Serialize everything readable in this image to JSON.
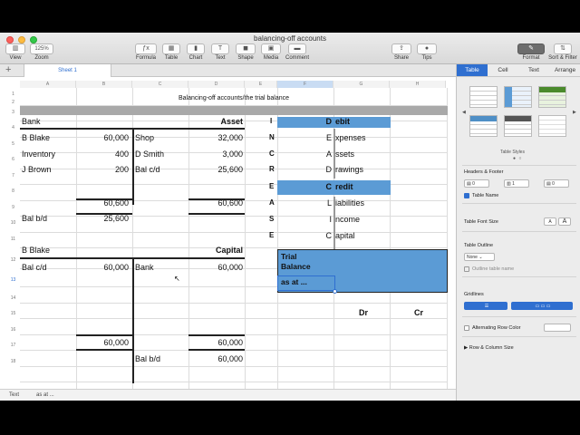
{
  "window": {
    "doc_title": "balancing-off accounts",
    "zoom_value": "125%"
  },
  "toolbar": {
    "view": "View",
    "zoom": "Zoom",
    "formula": "Formula",
    "table": "Table",
    "chart": "Chart",
    "text": "Text",
    "shape": "Shape",
    "media": "Media",
    "comment": "Comment",
    "share": "Share",
    "tips": "Tips",
    "format": "Format",
    "sort_filter": "Sort & Filter"
  },
  "sheet_tab": "Sheet 1",
  "columns": [
    "A",
    "B",
    "C",
    "D",
    "E",
    "F",
    "G",
    "H"
  ],
  "rows": [
    "1",
    "2",
    "3",
    "4",
    "5",
    "6",
    "7",
    "8",
    "9",
    "10",
    "11",
    "12",
    "13",
    "14",
    "15",
    "16",
    "17",
    "18"
  ],
  "heading": "Balancing-off accounts/the trial balance",
  "ledger": {
    "bank_title": "Bank",
    "asset_label": "Asset",
    "b_blake": "B Blake",
    "b_blake_amt": "60,000",
    "shop": "Shop",
    "shop_amt": "32,000",
    "inventory": "Inventory",
    "inventory_amt": "400",
    "d_smith": "D Smith",
    "d_smith_amt": "3,000",
    "j_brown": "J Brown",
    "j_brown_amt": "200",
    "bal_cd": "Bal c/d",
    "bal_cd_amt": "25,600",
    "total_left": "60,600",
    "total_right": "60,600",
    "bal_bd": "Bal b/d",
    "bal_bd_amt": "25,600",
    "b_blake2": "B Blake",
    "capital_label": "Capital",
    "bal_cd2": "Bal c/d",
    "bal_cd2_amt": "60,000",
    "bank2": "Bank",
    "bank2_amt": "60,000",
    "total2_left": "60,000",
    "total2_right": "60,000",
    "bal_bd2": "Bal b/d",
    "bal_bd2_amt": "60,000"
  },
  "dealer": {
    "letters": [
      "I",
      "N",
      "C",
      "R",
      "E",
      "A",
      "S",
      "E"
    ],
    "first": [
      "D",
      "E",
      "A",
      "D",
      "C",
      "L",
      "I",
      "C"
    ],
    "rest": [
      "ebit",
      "xpenses",
      "ssets",
      "rawings",
      "redit",
      "iabilities",
      "ncome",
      "apital"
    ]
  },
  "trial": {
    "line1": "Trial",
    "line2": "Balance",
    "line3": "as at ...",
    "dr": "Dr",
    "cr": "Cr"
  },
  "status": {
    "type": "Text",
    "content": "as at ..."
  },
  "inspector": {
    "tabs": [
      "Table",
      "Cell",
      "Text",
      "Arrange"
    ],
    "table_styles": "Table Styles",
    "headers_footer": "Headers & Footer",
    "header_rows": "0",
    "header_cols": "1",
    "footer_rows": "0",
    "table_name": "Table Name",
    "table_font_size": "Table Font Size",
    "font_small": "A",
    "font_large": "A",
    "table_outline": "Table Outline",
    "outline_value": "None",
    "outline_table_name": "Outline table name",
    "gridlines": "Gridlines",
    "alternating_row_color": "Alternating Row Color",
    "row_column_size": "Row & Column Size"
  },
  "colors": {
    "accent": "#2f6fd0",
    "highlight_fill": "#5b9bd5",
    "header_band": "#a9a9a9"
  }
}
